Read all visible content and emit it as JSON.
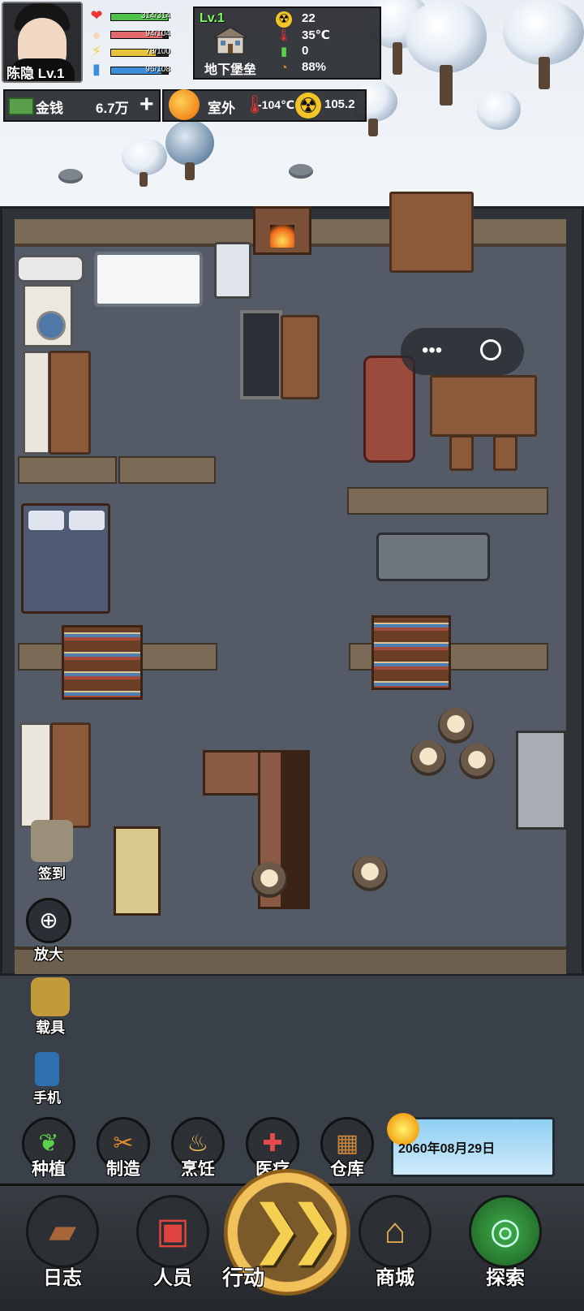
{
  "player": {
    "name_level": "陈隐 Lv.1"
  },
  "stats": [
    {
      "text": "314/314",
      "fraction": 1.0,
      "color": "#4cc24a",
      "icon": "heart-icon"
    },
    {
      "text": "94/104",
      "fraction": 0.9,
      "color": "#e26a6a",
      "icon": "stomach-icon"
    },
    {
      "text": "78/100",
      "fraction": 0.78,
      "color": "#e8c33a",
      "icon": "energy-icon"
    },
    {
      "text": "96/108",
      "fraction": 0.89,
      "color": "#3a8fd8",
      "icon": "water-icon"
    }
  ],
  "bunker": {
    "level": "Lv.1",
    "name": "地下堡垒",
    "radiation": "22",
    "temperature": "35℃",
    "power": "0",
    "humidity": "88%"
  },
  "money": {
    "label": "金钱",
    "value": "6.7万",
    "add": "+"
  },
  "outside": {
    "label": "室外",
    "temperature": "-104℃",
    "radiation": "105.2"
  },
  "side_buttons": {
    "checkin": "签到",
    "zoom": "放大",
    "vehicle": "载具",
    "phone": "手机"
  },
  "actions": [
    {
      "label": "种植",
      "icon": "sprout-icon"
    },
    {
      "label": "制造",
      "icon": "tools-icon"
    },
    {
      "label": "烹饪",
      "icon": "pot-icon"
    },
    {
      "label": "医疗",
      "icon": "medkit-icon"
    },
    {
      "label": "仓库",
      "icon": "crate-icon"
    }
  ],
  "date": "2060年08月29日",
  "nav": {
    "log": "日志",
    "staff": "人员",
    "action": "行动",
    "shop": "商城",
    "explore": "探索"
  },
  "colors": {
    "accent": "#f2c25a",
    "level_green": "#7cff5a"
  }
}
